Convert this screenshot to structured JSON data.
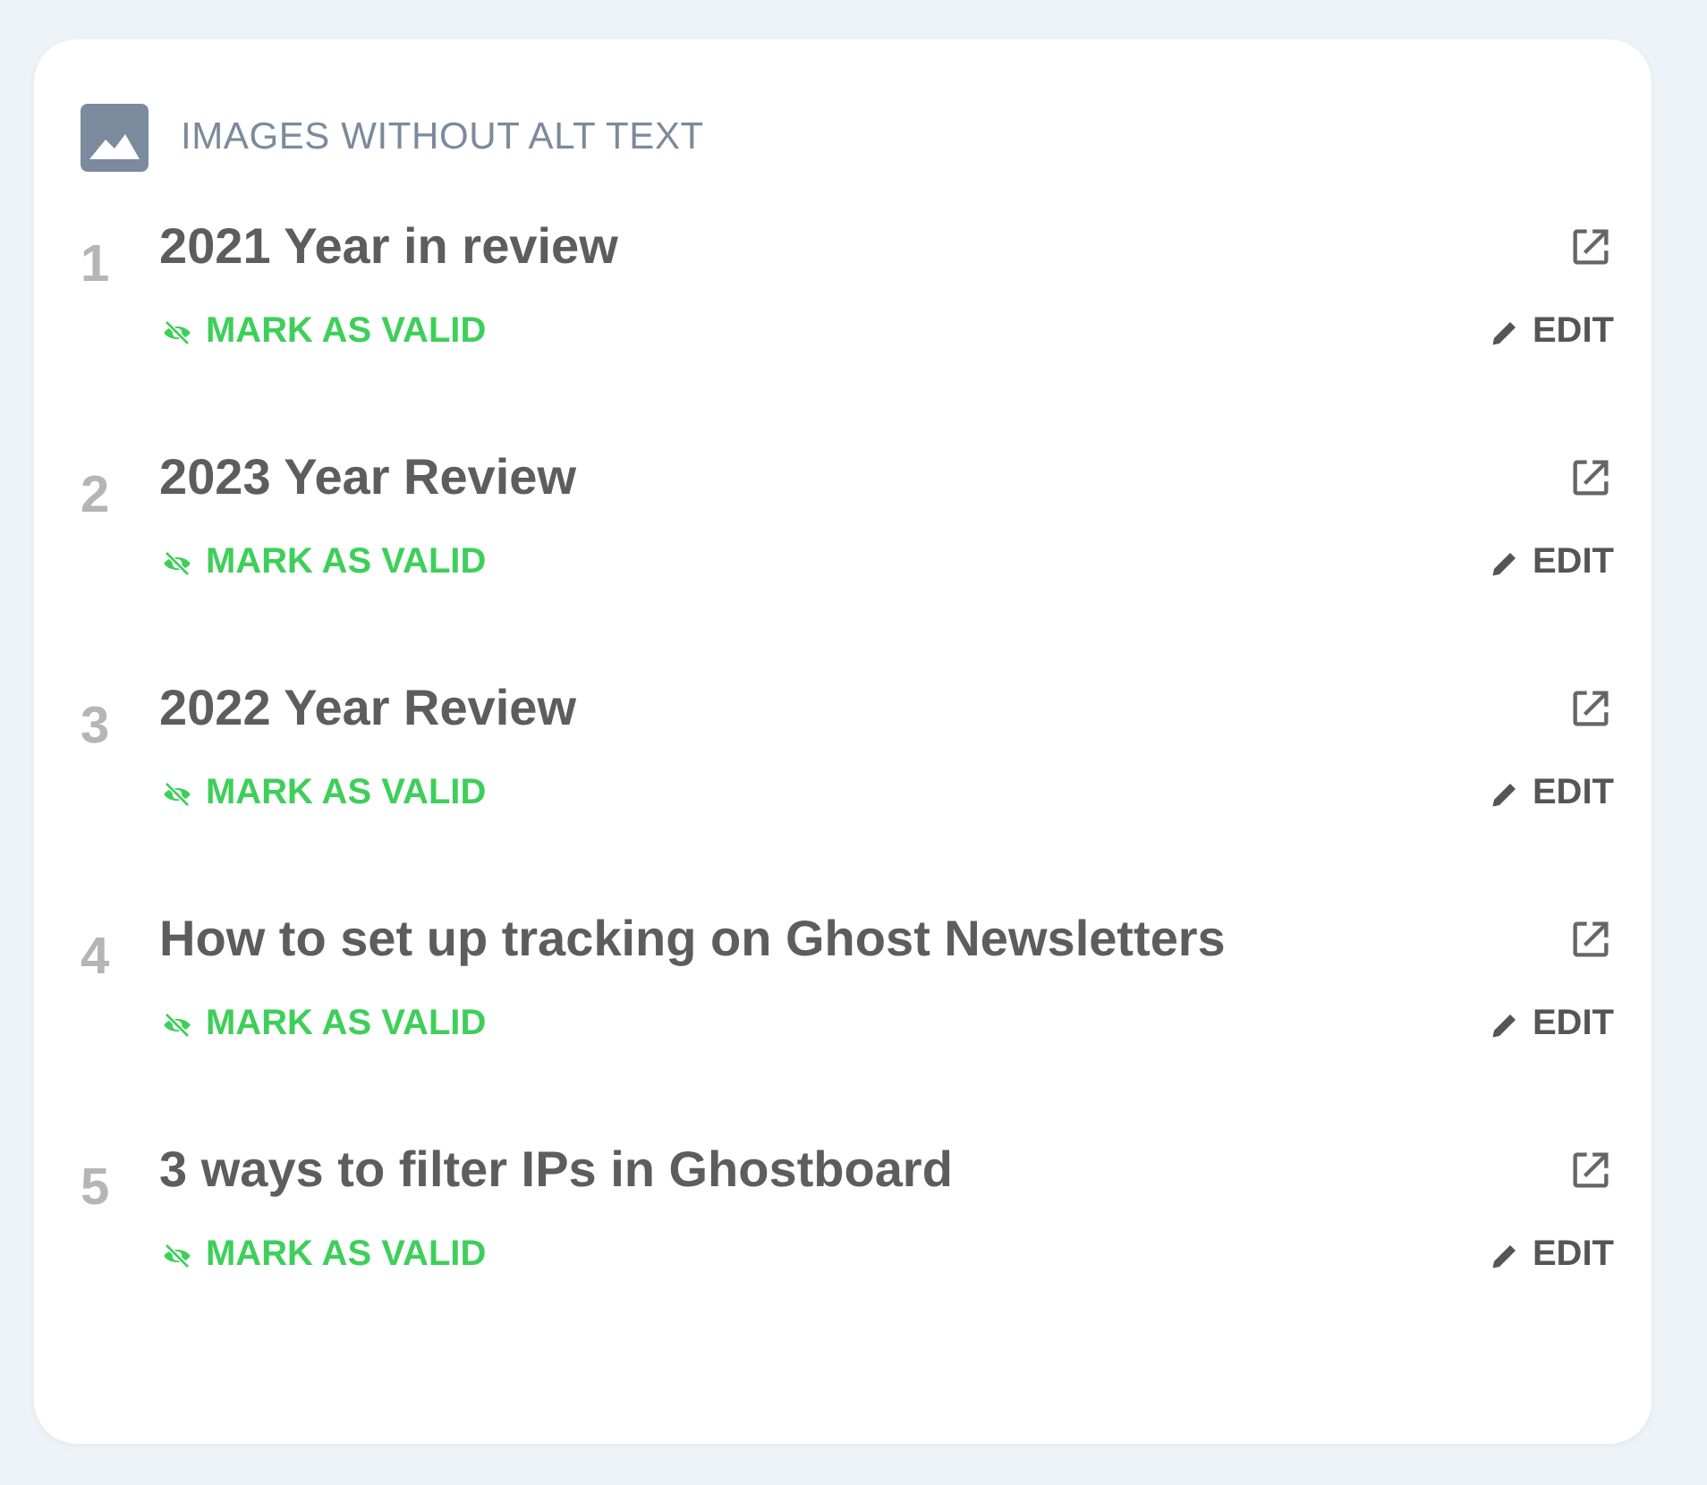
{
  "card": {
    "title": "IMAGES WITHOUT ALT TEXT",
    "items": [
      {
        "number": "1",
        "title": "2021 Year in review",
        "mark_label": "MARK AS VALID",
        "edit_label": "EDIT"
      },
      {
        "number": "2",
        "title": "2023 Year Review",
        "mark_label": "MARK AS VALID",
        "edit_label": "EDIT"
      },
      {
        "number": "3",
        "title": "2022 Year Review",
        "mark_label": "MARK AS VALID",
        "edit_label": "EDIT"
      },
      {
        "number": "4",
        "title": "How to set up tracking on Ghost Newsletters",
        "mark_label": "MARK AS VALID",
        "edit_label": "EDIT"
      },
      {
        "number": "5",
        "title": "3 ways to filter IPs in Ghostboard",
        "mark_label": "MARK AS VALID",
        "edit_label": "EDIT"
      }
    ]
  }
}
